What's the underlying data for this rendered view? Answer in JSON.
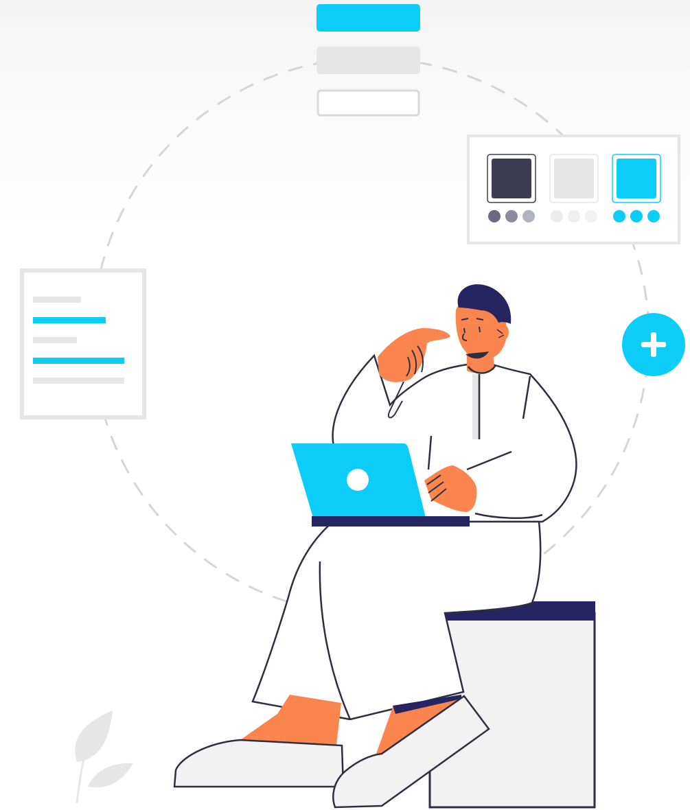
{
  "illustration": {
    "kind": "customization illustration",
    "icons": [
      "plus-icon",
      "laptop-logo-icon",
      "leaf-icon"
    ]
  },
  "colors": {
    "accent": "#0BCDF7",
    "dark_swatch": "#3F3D56",
    "navy": "#262562",
    "skin": "#FB854F",
    "light_gray": "#E6E6E6",
    "outline": "#2F2E41",
    "seat": "#F2F2F2"
  },
  "swatch_panel": {
    "swatches": [
      {
        "name": "dark",
        "color": "#3F3D56",
        "dots": [
          "#6B6A7E",
          "#8C8B9D",
          "#B3B2BF"
        ]
      },
      {
        "name": "light",
        "color": "#E6E6E6",
        "dots": [
          "#EBEBEB",
          "#EFEFEF",
          "#F2F2F2"
        ]
      },
      {
        "name": "accent",
        "color": "#0BCDF7",
        "dots": [
          "#0BCDF7",
          "#0BCDF7",
          "#0BCDF7"
        ]
      }
    ]
  },
  "button_stack": {
    "styles": [
      "filled-accent",
      "filled-gray",
      "outlined"
    ]
  },
  "document_card": {
    "lines": [
      "gray",
      "accent",
      "gray",
      "accent",
      "gray"
    ]
  }
}
